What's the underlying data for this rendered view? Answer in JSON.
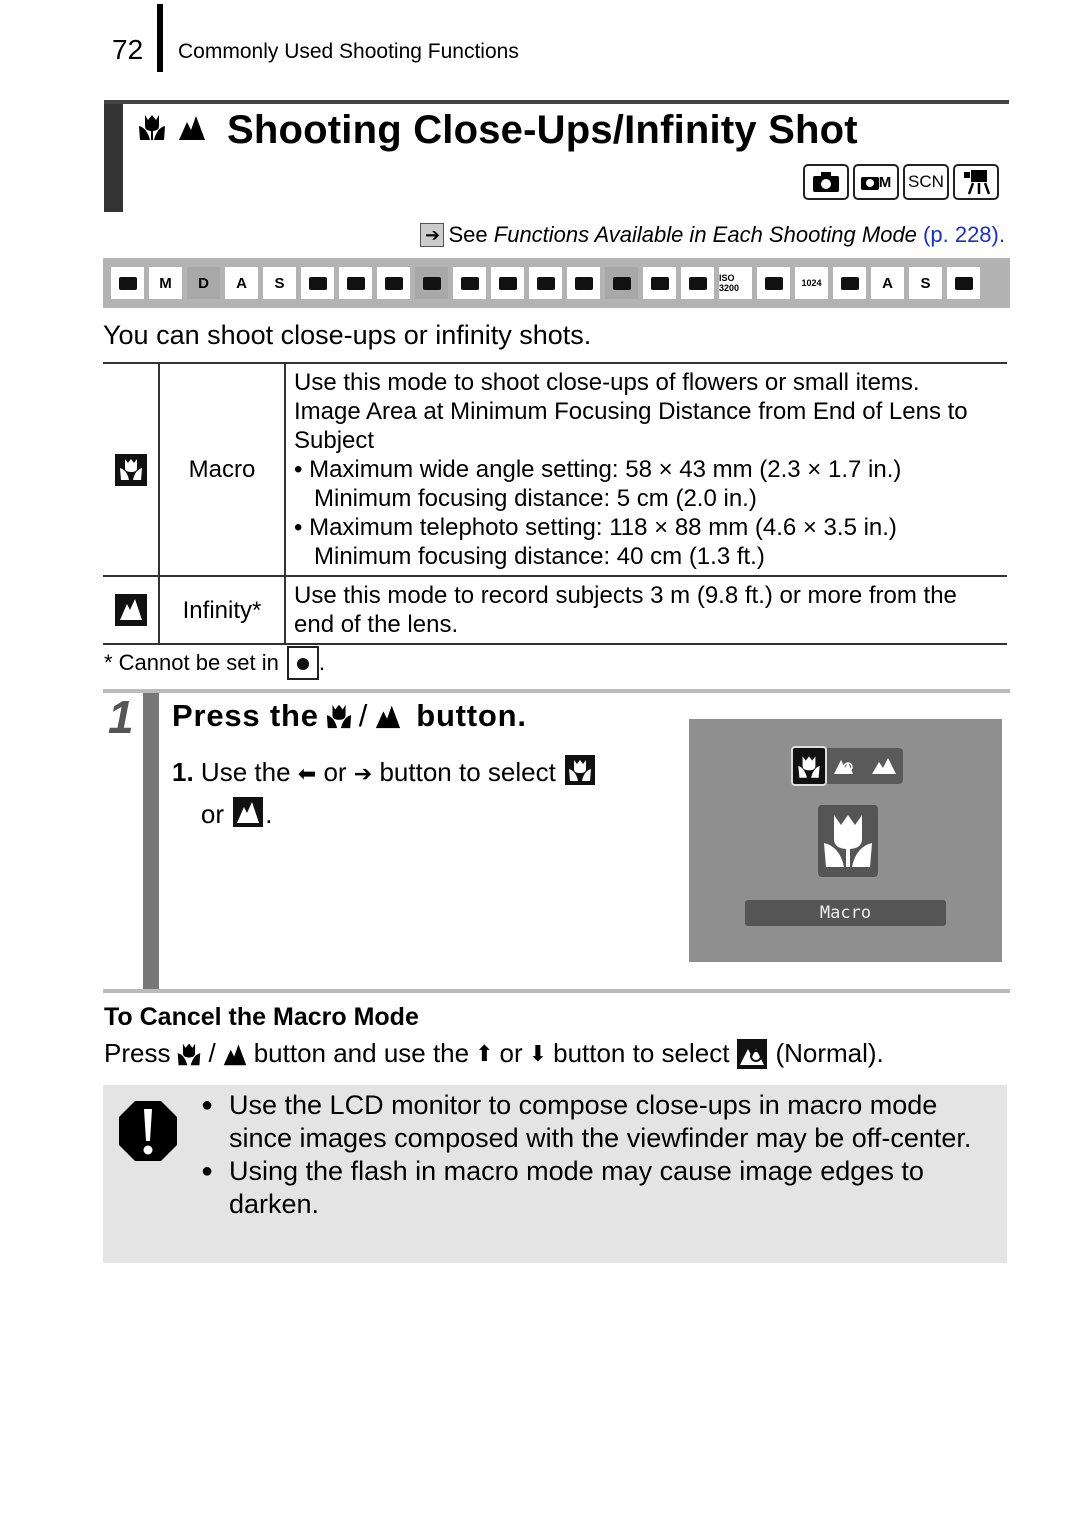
{
  "header": {
    "page_number": "72",
    "section_title": "Commonly Used Shooting Functions"
  },
  "title": {
    "icons": [
      "macro-icon",
      "infinity-icon"
    ],
    "text": "Shooting Close-Ups/Infinity Shot",
    "mode_badges": [
      {
        "icon": "camera-auto-icon",
        "label": ""
      },
      {
        "icon": "camera-manual-icon",
        "label": "M"
      },
      {
        "icon": "scene-icon",
        "label": "SCN"
      },
      {
        "icon": "movie-icon",
        "label": ""
      }
    ]
  },
  "see_reference": {
    "prefix": "See ",
    "italic": "Functions Available in Each Shooting Mode",
    "link": "(p. 228)",
    "suffix": "."
  },
  "mode_strip": [
    {
      "name": "auto",
      "label": "",
      "available": true
    },
    {
      "name": "manual",
      "label": "M",
      "available": true
    },
    {
      "name": "digital-macro",
      "label": "D",
      "available": false
    },
    {
      "name": "color-accent",
      "label": "A",
      "available": true
    },
    {
      "name": "color-swap",
      "label": "S",
      "available": true
    },
    {
      "name": "stitch-assist",
      "label": "",
      "available": true
    },
    {
      "name": "portrait",
      "label": "",
      "available": true
    },
    {
      "name": "night-snapshot",
      "label": "",
      "available": true
    },
    {
      "name": "kids-pets",
      "label": "",
      "available": false
    },
    {
      "name": "indoor",
      "label": "",
      "available": true
    },
    {
      "name": "foliage",
      "label": "",
      "available": true
    },
    {
      "name": "snow",
      "label": "",
      "available": true
    },
    {
      "name": "beach",
      "label": "",
      "available": true
    },
    {
      "name": "fireworks",
      "label": "",
      "available": false
    },
    {
      "name": "aquarium",
      "label": "",
      "available": true
    },
    {
      "name": "underwater",
      "label": "",
      "available": true
    },
    {
      "name": "iso-3200",
      "label": "ISO 3200",
      "available": true
    },
    {
      "name": "movie-standard",
      "label": "",
      "available": true
    },
    {
      "name": "movie-1024",
      "label": "1024",
      "available": true
    },
    {
      "name": "movie-compact",
      "label": "",
      "available": true
    },
    {
      "name": "movie-color-accent",
      "label": "A",
      "available": true
    },
    {
      "name": "movie-color-swap",
      "label": "S",
      "available": true
    },
    {
      "name": "movie-time-lapse",
      "label": "",
      "available": true
    }
  ],
  "intro": "You can shoot close-ups or infinity shots.",
  "table": {
    "rows": [
      {
        "icon": "macro-icon",
        "name": "Macro",
        "lines": [
          {
            "type": "text",
            "text": "Use this mode to shoot close-ups of flowers or small items."
          },
          {
            "type": "text",
            "text": "Image Area at Minimum Focusing Distance from End of Lens to Subject"
          },
          {
            "type": "bullet",
            "text": "Maximum wide angle setting: 58 × 43 mm (2.3 × 1.7 in.)"
          },
          {
            "type": "sub",
            "text": "Minimum focusing distance: 5 cm (2.0 in.)"
          },
          {
            "type": "bullet",
            "text": "Maximum telephoto setting: 118 × 88 mm (4.6 × 3.5 in.)"
          },
          {
            "type": "sub",
            "text": "Minimum focusing distance: 40 cm (1.3 ft.)"
          }
        ]
      },
      {
        "icon": "infinity-icon",
        "name": "Infinity*",
        "lines": [
          {
            "type": "text",
            "text": "Use this mode to record subjects 3 m (9.8 ft.) or more from the end of the lens."
          }
        ]
      }
    ],
    "footnote": "*  Cannot be set in",
    "footnote_suffix": "."
  },
  "step": {
    "number": "1",
    "title_prefix": "Press the",
    "title_slash": "/",
    "title_suffix": "button.",
    "instruction": {
      "num": "1.",
      "part1": "Use the",
      "or1": "or",
      "part2": "button to select",
      "or2": "or",
      "end": "."
    },
    "lcd": {
      "options": [
        "macro",
        "normal",
        "infinity"
      ],
      "selected": "macro",
      "label": "Macro"
    }
  },
  "cancel": {
    "title": "To Cancel the Macro Mode",
    "press": "Press",
    "slash": "/",
    "mid": "button and use the",
    "or": "or",
    "end": "button to select",
    "normal": "(Normal)."
  },
  "caution": {
    "icon": "caution-icon",
    "items": [
      "Use the LCD monitor to compose close-ups in macro mode since images composed with the viewfinder may be off-center.",
      "Using the flash in macro mode may cause image edges to darken."
    ]
  }
}
